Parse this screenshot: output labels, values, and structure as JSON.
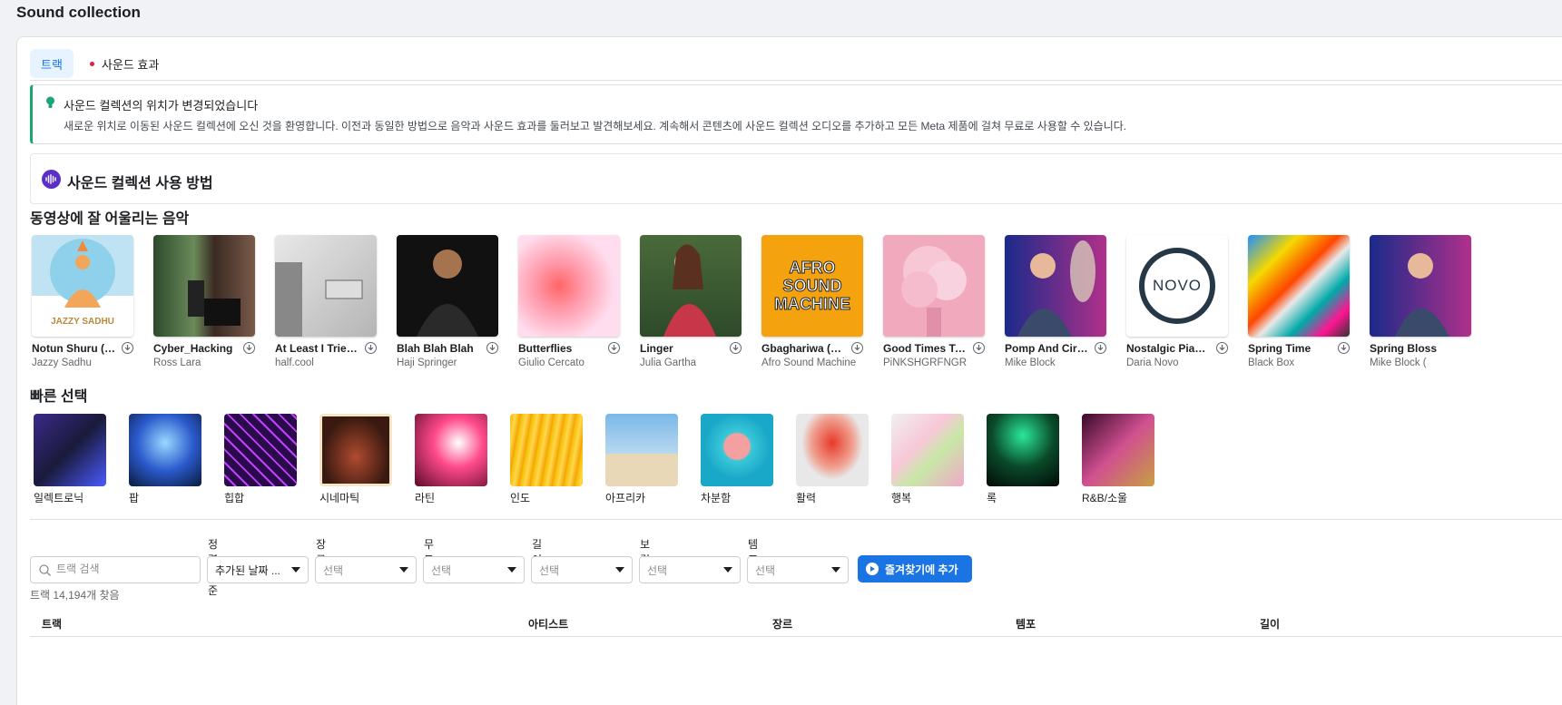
{
  "page": {
    "title": "Sound collection"
  },
  "tabs": [
    {
      "label": "트랙",
      "active": true
    },
    {
      "label": "사운드 효과",
      "active": false
    }
  ],
  "notice": {
    "title": "사운드 컬렉션의 위치가 변경되었습니다",
    "body": "새로운 위치로 이동된 사운드 컬렉션에 오신 것을 환영합니다. 이전과 동일한 방법으로 음악과 사운드 효과를 둘러보고 발견해보세요. 계속해서 콘텐츠에 사운드 컬렉션 오디오를 추가하고 모든 Meta 제품에 걸쳐 무료로 사용할 수 있습니다."
  },
  "howto": {
    "title": "사운드 컬렉션 사용 방법"
  },
  "music_section": {
    "title": "동영상에 잘 어울리는 음악",
    "tracks": [
      {
        "title": "Notun Shuru (N...",
        "artist": "Jazzy Sadhu",
        "art_text": "JAZZY SADHU"
      },
      {
        "title": "Cyber_Hacking",
        "artist": "Ross Lara",
        "art_text": ""
      },
      {
        "title": "At Least I Tried ...",
        "artist": "half.cool",
        "art_text": ""
      },
      {
        "title": "Blah Blah Blah",
        "artist": "Haji Springer",
        "art_text": ""
      },
      {
        "title": "Butterflies",
        "artist": "Giulio Cercato",
        "art_text": ""
      },
      {
        "title": "Linger",
        "artist": "Julia Gartha",
        "art_text": ""
      },
      {
        "title": "Gbaghariwa (Ke...",
        "artist": "Afro Sound Machine",
        "art_text": "AFRO SOUND MACHINE"
      },
      {
        "title": "Good Times To...",
        "artist": "PiNKSHGRFNGR",
        "art_text": ""
      },
      {
        "title": "Pomp And Circ...",
        "artist": "Mike Block",
        "art_text": ""
      },
      {
        "title": "Nostalgic Piano...",
        "artist": "Daria Novo",
        "art_text": "NOVO"
      },
      {
        "title": "Spring Time",
        "artist": "Black Box",
        "art_text": ""
      },
      {
        "title": "Spring Bloss",
        "artist": "Mike Block (",
        "art_text": ""
      }
    ]
  },
  "quick_section": {
    "title": "빠른 선택",
    "items": [
      {
        "label": "일렉트로닉"
      },
      {
        "label": "팝"
      },
      {
        "label": "힙합"
      },
      {
        "label": "시네마틱"
      },
      {
        "label": "라틴"
      },
      {
        "label": "인도"
      },
      {
        "label": "아프리카"
      },
      {
        "label": "차분함"
      },
      {
        "label": "활력"
      },
      {
        "label": "행복"
      },
      {
        "label": "록"
      },
      {
        "label": "R&B/소울"
      }
    ]
  },
  "filters": {
    "search_placeholder": "트랙 검색",
    "sort_label": "정렬 기준",
    "sort_value": "추가된 날짜 ...",
    "genre_label": "장르",
    "mood_label": "무드",
    "length_label": "길이",
    "vocal_label": "보컬",
    "tempo_label": "템포",
    "select_placeholder": "선택",
    "favorite_button": "즐겨찾기에 추가"
  },
  "results": {
    "count_text": "트랙 14,194개 찾음"
  },
  "table": {
    "headers": [
      "트랙",
      "아티스트",
      "장르",
      "템포",
      "길이"
    ]
  },
  "colors": {
    "accent": "#1b74e4",
    "notice_bar": "#1ba672",
    "howto_icon": "#5b2ec6"
  }
}
